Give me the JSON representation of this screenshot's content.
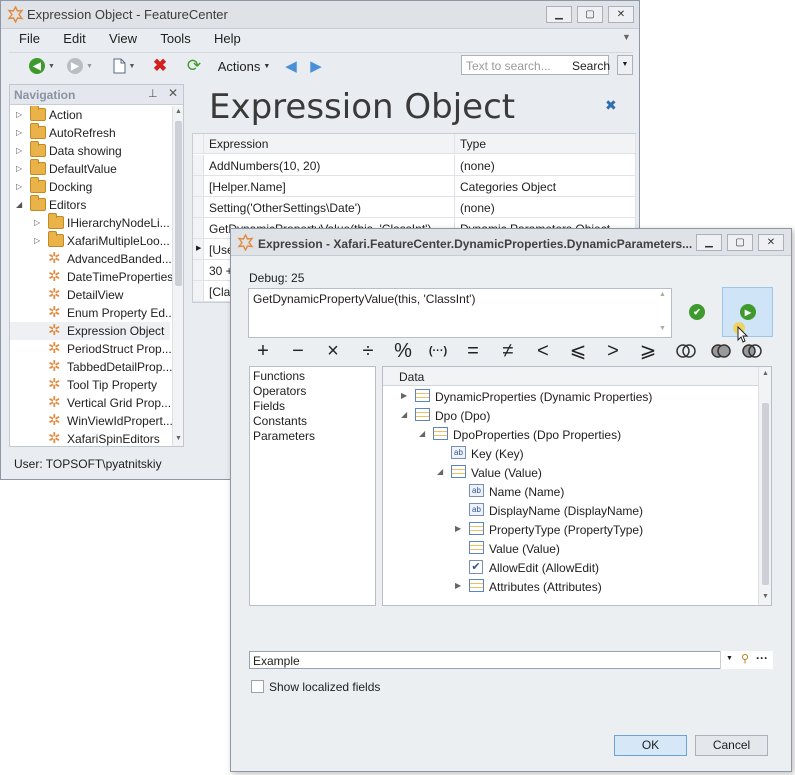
{
  "main_window": {
    "title": "Expression Object - FeatureCenter",
    "menu": [
      "File",
      "Edit",
      "View",
      "Tools",
      "Help"
    ],
    "toolbar": {
      "actions_label": "Actions",
      "search_placeholder": "Text to search...",
      "search_button": "Search"
    },
    "navigation": {
      "title": "Navigation",
      "items": [
        {
          "label": "Action",
          "type": "folder",
          "expand": "collapsed",
          "level": 0
        },
        {
          "label": "AutoRefresh",
          "type": "folder",
          "expand": "collapsed",
          "level": 0
        },
        {
          "label": "Data showing",
          "type": "folder",
          "expand": "collapsed",
          "level": 0
        },
        {
          "label": "DefaultValue",
          "type": "folder",
          "expand": "collapsed",
          "level": 0
        },
        {
          "label": "Docking",
          "type": "folder",
          "expand": "collapsed",
          "level": 0
        },
        {
          "label": "Editors",
          "type": "folder",
          "expand": "expanded",
          "level": 0
        },
        {
          "label": "IHierarchyNodeLi...",
          "type": "folder",
          "expand": "collapsed",
          "level": 1
        },
        {
          "label": "XafariMultipleLoo...",
          "type": "folder",
          "expand": "collapsed",
          "level": 1
        },
        {
          "label": "AdvancedBanded...",
          "type": "item",
          "level": 1
        },
        {
          "label": "DateTimeProperties",
          "type": "item",
          "level": 1
        },
        {
          "label": "DetailView",
          "type": "item",
          "level": 1
        },
        {
          "label": "Enum Property Ed...",
          "type": "item",
          "level": 1
        },
        {
          "label": "Expression Object",
          "type": "item",
          "level": 1,
          "selected": true
        },
        {
          "label": "PeriodStruct Prop...",
          "type": "item",
          "level": 1
        },
        {
          "label": "TabbedDetailProp...",
          "type": "item",
          "level": 1
        },
        {
          "label": "Tool Tip Property",
          "type": "item",
          "level": 1
        },
        {
          "label": "Vertical Grid Prop...",
          "type": "item",
          "level": 1
        },
        {
          "label": "WinViewIdPropert...",
          "type": "item",
          "level": 1
        },
        {
          "label": "XafariSpinEditors",
          "type": "item",
          "level": 1
        }
      ]
    },
    "status": "User: TOPSOFT\\pyatnitskiy",
    "view_title": "Expression Object",
    "grid": {
      "columns": [
        "Expression",
        "Type"
      ],
      "rows": [
        {
          "expression": "AddNumbers(10, 20)",
          "type": "(none)"
        },
        {
          "expression": "[Helper.Name]",
          "type": "Categories Object"
        },
        {
          "expression": "Setting('OtherSettings\\Date')",
          "type": "(none)"
        },
        {
          "expression": "GetDynamicPropertyValue(this, 'ClassInt')",
          "type": "Dynamic Parameters Object"
        },
        {
          "expression": "[Use",
          "type": ""
        },
        {
          "expression": "30 +",
          "type": ""
        },
        {
          "expression": "[Clas",
          "type": ""
        }
      ]
    }
  },
  "dialog": {
    "title": "Expression - Xafari.FeatureCenter.DynamicProperties.DynamicParameters...",
    "debug_label": "Debug: 25",
    "expression": "GetDynamicPropertyValue(this, 'ClassInt')",
    "operators": [
      "+",
      "−",
      "×",
      "÷",
      "%",
      "(···)",
      "=",
      "≠",
      "<",
      "⩽",
      ">",
      "⩾"
    ],
    "categories": [
      "Functions",
      "Operators",
      "Fields",
      "Constants",
      "Parameters"
    ],
    "selected_category": "Fields",
    "data_header": "Data",
    "tree": [
      {
        "label": "DynamicProperties (Dynamic Properties)",
        "icon": "table",
        "expand": "collapsed",
        "level": 0
      },
      {
        "label": "Dpo (Dpo)",
        "icon": "table",
        "expand": "expanded",
        "level": 0
      },
      {
        "label": "DpoProperties (Dpo Properties)",
        "icon": "table",
        "expand": "expanded",
        "level": 1
      },
      {
        "label": "Key (Key)",
        "icon": "ab",
        "expand": "none",
        "level": 2
      },
      {
        "label": "Value (Value)",
        "icon": "table",
        "expand": "expanded",
        "level": 2
      },
      {
        "label": "Name (Name)",
        "icon": "ab",
        "expand": "none",
        "level": 3
      },
      {
        "label": "DisplayName (DisplayName)",
        "icon": "ab",
        "expand": "none",
        "level": 3
      },
      {
        "label": "PropertyType (PropertyType)",
        "icon": "table",
        "expand": "collapsed",
        "level": 3
      },
      {
        "label": "Value (Value)",
        "icon": "table",
        "expand": "none",
        "level": 3
      },
      {
        "label": "AllowEdit (AllowEdit)",
        "icon": "check",
        "expand": "none",
        "level": 3
      },
      {
        "label": "Attributes (Attributes)",
        "icon": "table",
        "expand": "collapsed",
        "level": 3
      }
    ],
    "example": "Example",
    "show_localized": "Show localized fields",
    "ok": "OK",
    "cancel": "Cancel"
  }
}
